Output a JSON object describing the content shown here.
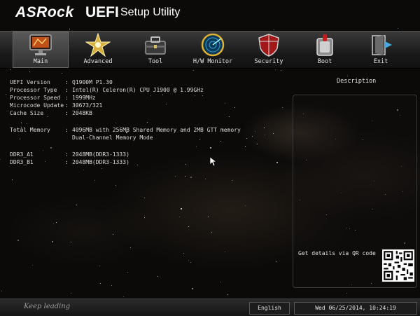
{
  "header": {
    "logo": "ASRock",
    "title_main": "UEFI",
    "title_sub": "Setup Utility"
  },
  "nav": {
    "tabs": [
      {
        "label": "Main",
        "icon": "monitor-icon",
        "active": true
      },
      {
        "label": "Advanced",
        "icon": "star-burst-icon",
        "active": false
      },
      {
        "label": "Tool",
        "icon": "toolbox-icon",
        "active": false
      },
      {
        "label": "H/W Monitor",
        "icon": "radar-icon",
        "active": false
      },
      {
        "label": "Security",
        "icon": "shield-icon",
        "active": false
      },
      {
        "label": "Boot",
        "icon": "power-switch-icon",
        "active": false
      },
      {
        "label": "Exit",
        "icon": "exit-door-icon",
        "active": false
      }
    ]
  },
  "info": {
    "rows": [
      {
        "key": "UEFI Version",
        "value": "Q1900M P1.30"
      },
      {
        "key": "Processor Type",
        "value": "Intel(R) Celeron(R) CPU J1900 @ 1.99GHz"
      },
      {
        "key": "Processor Speed",
        "value": "1999MHz"
      },
      {
        "key": "Microcode Update",
        "value": "30673/321"
      },
      {
        "key": "Cache Size",
        "value": "2048KB"
      },
      {
        "key": "Total Memory",
        "value": "4096MB with 256MB Shared Memory and 2MB GTT memory"
      },
      {
        "key": "",
        "value": "Dual-Channel Memory Mode"
      },
      {
        "key": "DDR3_A1",
        "value": "2048MB(DDR3-1333)"
      },
      {
        "key": "DDR3_B1",
        "value": "2048MB(DDR3-1333)"
      }
    ],
    "separator": ":"
  },
  "description": {
    "title": "Description",
    "qr_text": "Get details via QR code"
  },
  "footer": {
    "slogan": "Keep leading",
    "language": "English",
    "datetime": "Wed 06/25/2014, 10:24:19"
  }
}
